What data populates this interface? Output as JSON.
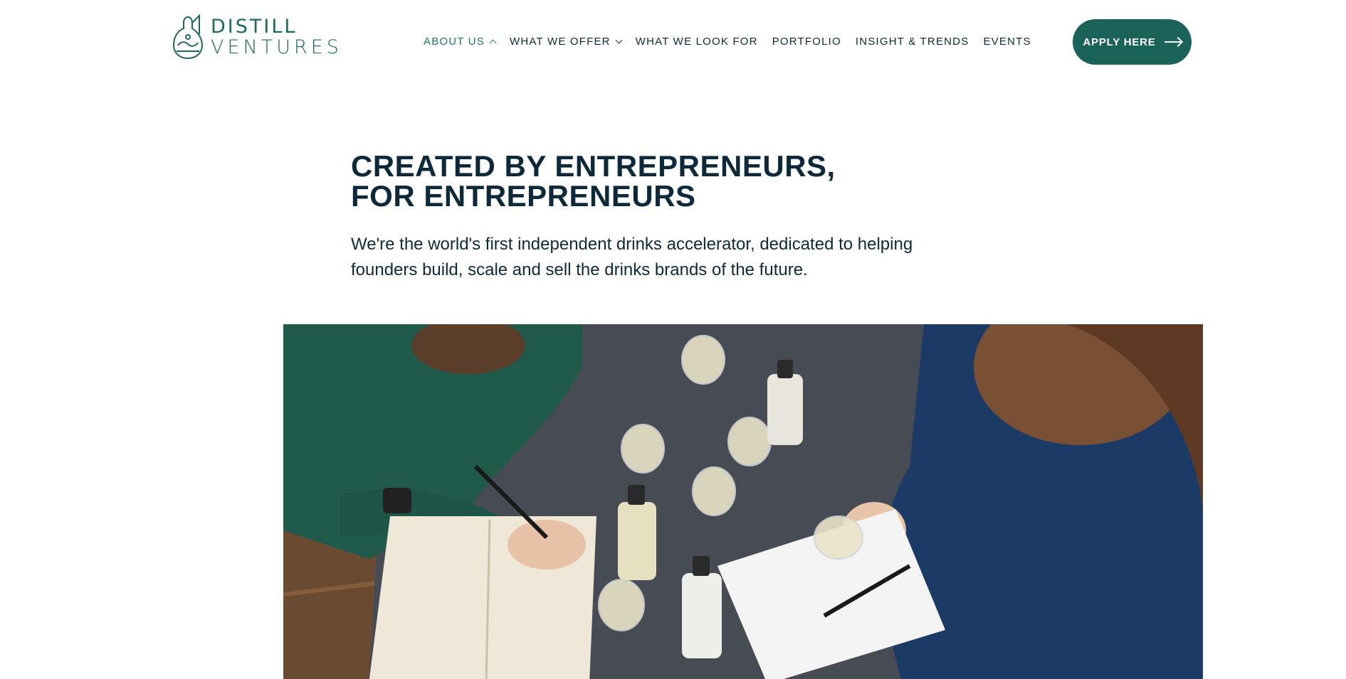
{
  "brand": {
    "line1": "DISTILL",
    "line2": "VENTURES",
    "color": "#1c6a5e"
  },
  "nav": {
    "items": [
      {
        "label": "ABOUT US",
        "dropdown": true,
        "active": true,
        "chevron": "chevron-up"
      },
      {
        "label": "WHAT WE OFFER",
        "dropdown": true,
        "active": false,
        "chevron": "chevron-down"
      },
      {
        "label": "WHAT WE LOOK FOR",
        "dropdown": false,
        "active": false
      },
      {
        "label": "PORTFOLIO",
        "dropdown": false,
        "active": false
      },
      {
        "label": "INSIGHT & TRENDS",
        "dropdown": false,
        "active": false
      },
      {
        "label": "EVENTS",
        "dropdown": false,
        "active": false
      }
    ],
    "active_color": "#1c7a6b",
    "text_color": "#0e2a3a"
  },
  "cta": {
    "label": "APPLY HERE",
    "icon": "arrow-right-icon",
    "background": "#1b6358"
  },
  "hero": {
    "title": "CREATED BY ENTREPRENEURS, FOR ENTREPRENEURS",
    "text": "We're the world's first independent drinks accelerator, dedicated to helping founders build, scale and sell the drinks brands of the future."
  }
}
